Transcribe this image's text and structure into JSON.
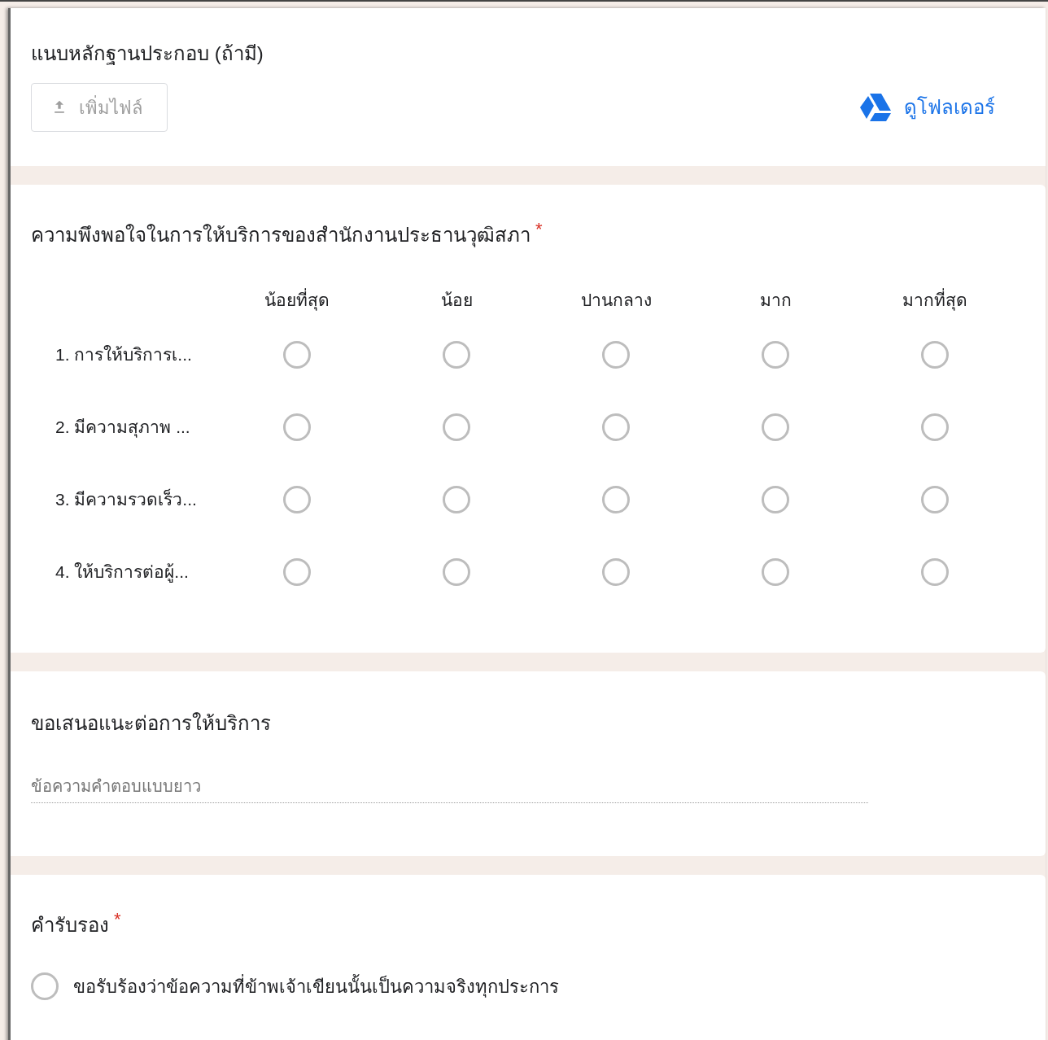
{
  "upload_section": {
    "title": "แนบหลักฐานประกอบ (ถ้ามี)",
    "add_file_button": "เพิ่มไฟล์",
    "disabled": true,
    "folder_link": "ดูโฟลเดอร์"
  },
  "grid_question": {
    "title": "ความพึงพอใจในการให้บริการของสำนักงานประธานวุฒิสภา",
    "required": true,
    "required_mark": "*",
    "columns": [
      "น้อยที่สุด",
      "น้อย",
      "ปานกลาง",
      "มาก",
      "มากที่สุด"
    ],
    "rows": [
      {
        "label": "1. การให้บริการเ...",
        "choices": [
          {
            "selected": false
          },
          {
            "selected": false
          },
          {
            "selected": false
          },
          {
            "selected": false
          },
          {
            "selected": false
          }
        ]
      },
      {
        "label": "2. มีความสุภาพ ...",
        "choices": [
          {
            "selected": false
          },
          {
            "selected": false
          },
          {
            "selected": false
          },
          {
            "selected": false
          },
          {
            "selected": false
          }
        ]
      },
      {
        "label": "3. มีความรวดเร็ว...",
        "choices": [
          {
            "selected": false
          },
          {
            "selected": false
          },
          {
            "selected": false
          },
          {
            "selected": false
          },
          {
            "selected": false
          }
        ]
      },
      {
        "label": "4. ให้บริการต่อผู้...",
        "choices": [
          {
            "selected": false
          },
          {
            "selected": false
          },
          {
            "selected": false
          },
          {
            "selected": false
          },
          {
            "selected": false
          }
        ]
      }
    ]
  },
  "suggestion_question": {
    "title": "ขอเสนอแนะต่อการให้บริการ",
    "placeholder": "ข้อความคำตอบแบบยาว"
  },
  "certification_question": {
    "title": "คำรับรอง",
    "required": true,
    "required_mark": "*",
    "options": [
      {
        "label": "ขอรับร้องว่าข้อความที่ข้าพเจ้าเขียนนั้นเป็นความจริงทุกประการ",
        "selected": false
      }
    ]
  }
}
